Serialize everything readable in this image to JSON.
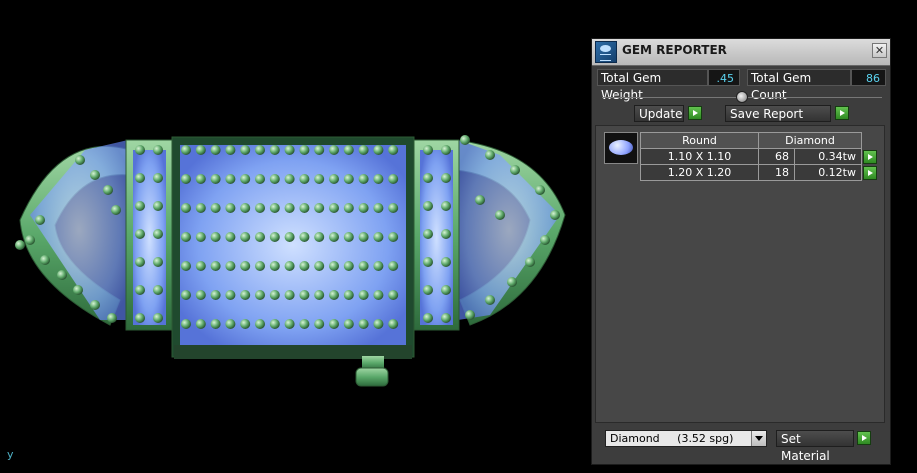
{
  "viewport": {
    "axis_label": "y"
  },
  "panel": {
    "title": "GEM REPORTER",
    "close_glyph": "✕",
    "total_weight_label": "Total Gem Weight",
    "total_weight_value": ".45",
    "total_count_label": "Total Gem Count",
    "total_count_value": "86",
    "update_label": "Update",
    "save_report_label": "Save Report",
    "table": {
      "headers": [
        "Round",
        "Diamond"
      ],
      "rows": [
        {
          "size": "1.10 X 1.10",
          "count": "68",
          "weight": "0.34tw"
        },
        {
          "size": "1.20 X 1.20",
          "count": "18",
          "weight": "0.12tw"
        }
      ]
    },
    "material_select_value": "Diamond     (3.52 spg)",
    "set_material_label": "Set Material"
  },
  "icons": [
    "gem-reporter-app-icon",
    "close-icon",
    "play-icon",
    "dropdown-arrow-icon",
    "round-gem-icon"
  ],
  "colors": {
    "accent_green": "#3fa82f",
    "value_cyan": "#5ad3f0",
    "panel_bg": "#3d3d3d"
  }
}
